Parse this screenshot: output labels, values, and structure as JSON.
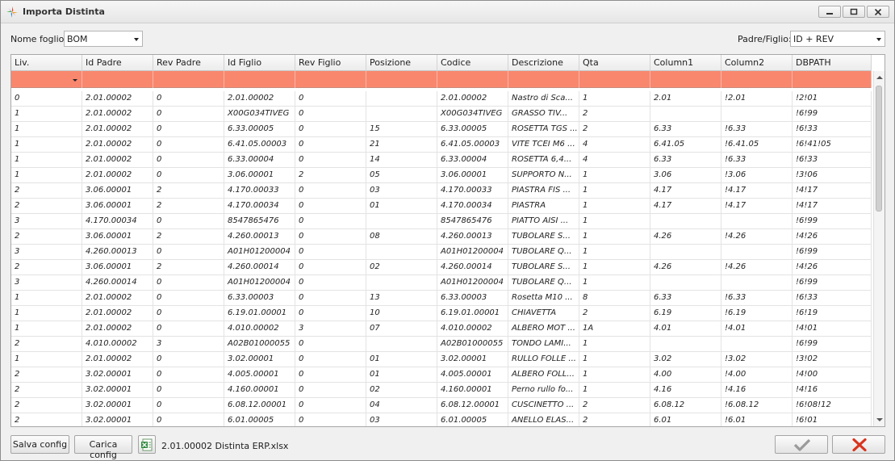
{
  "window": {
    "title": "Importa Distinta"
  },
  "controls": {
    "sheet_label": "Nome foglio:",
    "sheet_value": "BOM",
    "parent_child_label": "Padre/Figlio:",
    "parent_child_value": "ID + REV"
  },
  "grid": {
    "columns": [
      "Liv.",
      "Id Padre",
      "Rev Padre",
      "Id Figlio",
      "Rev Figlio",
      "Posizione",
      "Codice",
      "Descrizione",
      "Qta",
      "Column1",
      "Column2",
      "DBPATH"
    ],
    "rows": [
      [
        "0",
        "2.01.00002",
        "0",
        "2.01.00002",
        "0",
        "",
        "2.01.00002",
        "Nastro di Sca...",
        "1",
        "2.01",
        "!2.01",
        "!2!01"
      ],
      [
        " 1",
        "2.01.00002",
        "0",
        "X00G034TIVEG",
        "0",
        "",
        "X00G034TIVEG",
        "GRASSO TIV...",
        "2",
        "",
        "",
        "!6!99"
      ],
      [
        " 1",
        "2.01.00002",
        "0",
        "6.33.00005",
        "0",
        "15",
        "6.33.00005",
        "ROSETTA TGS ...",
        "2",
        "6.33",
        "!6.33",
        "!6!33"
      ],
      [
        " 1",
        "2.01.00002",
        "0",
        "6.41.05.00003",
        "0",
        "21",
        "6.41.05.00003",
        "VITE TCEI M6 ...",
        "4",
        "6.41.05",
        "!6.41.05",
        "!6!41!05"
      ],
      [
        " 1",
        "2.01.00002",
        "0",
        "6.33.00004",
        "0",
        "14",
        "6.33.00004",
        "ROSETTA 6,4...",
        "4",
        "6.33",
        "!6.33",
        "!6!33"
      ],
      [
        " 1",
        "2.01.00002",
        "0",
        "3.06.00001",
        "2",
        "05",
        "3.06.00001",
        "SUPPORTO N...",
        "1",
        "3.06",
        "!3.06",
        "!3!06"
      ],
      [
        "  2",
        "3.06.00001",
        "2",
        "4.170.00033",
        "0",
        "03",
        "4.170.00033",
        "PIASTRA FIS ...",
        "1",
        "4.17",
        "!4.17",
        "!4!17"
      ],
      [
        "  2",
        "3.06.00001",
        "2",
        "4.170.00034",
        "0",
        "01",
        "4.170.00034",
        "PIASTRA",
        "1",
        "4.17",
        "!4.17",
        "!4!17"
      ],
      [
        "   3",
        "4.170.00034",
        "0",
        "8547865476",
        "0",
        "",
        "8547865476",
        "PIATTO AISI ...",
        "1",
        "",
        "",
        "!6!99"
      ],
      [
        "  2",
        "3.06.00001",
        "2",
        "4.260.00013",
        "0",
        "08",
        "4.260.00013",
        "TUBOLARE S...",
        "1",
        "4.26",
        "!4.26",
        "!4!26"
      ],
      [
        "   3",
        "4.260.00013",
        "0",
        "A01H01200004",
        "0",
        "",
        "A01H01200004",
        "TUBOLARE Q...",
        "1",
        "",
        "",
        "!6!99"
      ],
      [
        "  2",
        "3.06.00001",
        "2",
        "4.260.00014",
        "0",
        "02",
        "4.260.00014",
        "TUBOLARE S...",
        "1",
        "4.26",
        "!4.26",
        "!4!26"
      ],
      [
        "   3",
        "4.260.00014",
        "0",
        "A01H01200004",
        "0",
        "",
        "A01H01200004",
        "TUBOLARE Q...",
        "1",
        "",
        "",
        "!6!99"
      ],
      [
        " 1",
        "2.01.00002",
        "0",
        "6.33.00003",
        "0",
        "13",
        "6.33.00003",
        "Rosetta M10 ...",
        "8",
        "6.33",
        "!6.33",
        "!6!33"
      ],
      [
        " 1",
        "2.01.00002",
        "0",
        "6.19.01.00001",
        "0",
        "10",
        "6.19.01.00001",
        "CHIAVETTA",
        "2",
        "6.19",
        "!6.19",
        "!6!19"
      ],
      [
        " 1",
        "2.01.00002",
        "0",
        "4.010.00002",
        "3",
        "07",
        "4.010.00002",
        "ALBERO MOT ...",
        "1A",
        "4.01",
        "!4.01",
        "!4!01"
      ],
      [
        "  2",
        "4.010.00002",
        "3",
        "A02B01000055",
        "0",
        "",
        "A02B01000055",
        "TONDO LAMI...",
        "1",
        "",
        "",
        "!6!99"
      ],
      [
        " 1",
        "2.01.00002",
        "0",
        "3.02.00001",
        "0",
        "01",
        "3.02.00001",
        "RULLO FOLLE ...",
        "1",
        "3.02",
        "!3.02",
        "!3!02"
      ],
      [
        "  2",
        "3.02.00001",
        "0",
        "4.005.00001",
        "0",
        "01",
        "4.005.00001",
        "ALBERO FOLL...",
        "1",
        "4.00",
        "!4.00",
        "!4!00"
      ],
      [
        "  2",
        "3.02.00001",
        "0",
        "4.160.00001",
        "0",
        "02",
        "4.160.00001",
        "Perno rullo fo...",
        "1",
        "4.16",
        "!4.16",
        "!4!16"
      ],
      [
        "  2",
        "3.02.00001",
        "0",
        "6.08.12.00001",
        "0",
        "04",
        "6.08.12.00001",
        "CUSCINETTO ...",
        "2",
        "6.08.12",
        "!6.08.12",
        "!6!08!12"
      ],
      [
        "  2",
        "3.02.00001",
        "0",
        "6.01.00005",
        "0",
        "03",
        "6.01.00005",
        "ANELLO ELAS...",
        "2",
        "6.01",
        "!6.01",
        "!6!01"
      ]
    ]
  },
  "footer": {
    "save_config": "Salva config",
    "load_config": "Carica config",
    "file_name": "2.01.00002 Distinta ERP.xlsx"
  },
  "colors": {
    "filter_row": "#f9876e",
    "ok_check": "#9a9a9a",
    "cancel_x": "#d9331f"
  },
  "icons": {
    "app": "app-logo-icon",
    "excel": "excel-file-icon",
    "ok": "checkmark-icon",
    "cancel": "close-x-icon"
  }
}
